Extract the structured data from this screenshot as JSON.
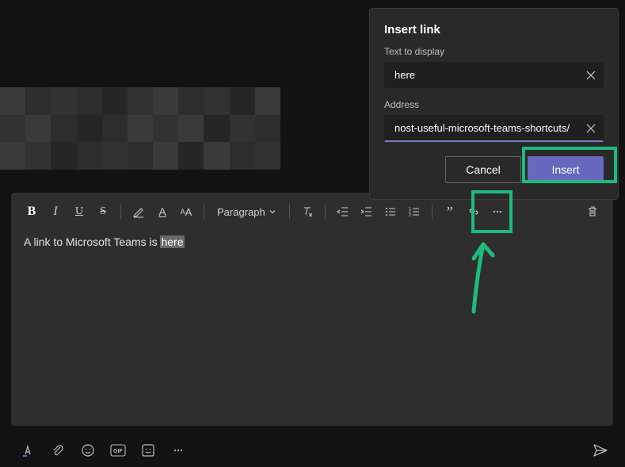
{
  "dialog": {
    "title": "Insert link",
    "display_label": "Text to display",
    "display_value": "here",
    "address_label": "Address",
    "address_value": "nost-useful-microsoft-teams-shortcuts/",
    "cancel_label": "Cancel",
    "insert_label": "Insert"
  },
  "toolbar": {
    "paragraph_label": "Paragraph"
  },
  "editor": {
    "text_prefix": "A link to Microsoft Teams is ",
    "text_selected": "here"
  },
  "colors": {
    "primary": "#6668bd",
    "highlight": "#1fba7c"
  }
}
